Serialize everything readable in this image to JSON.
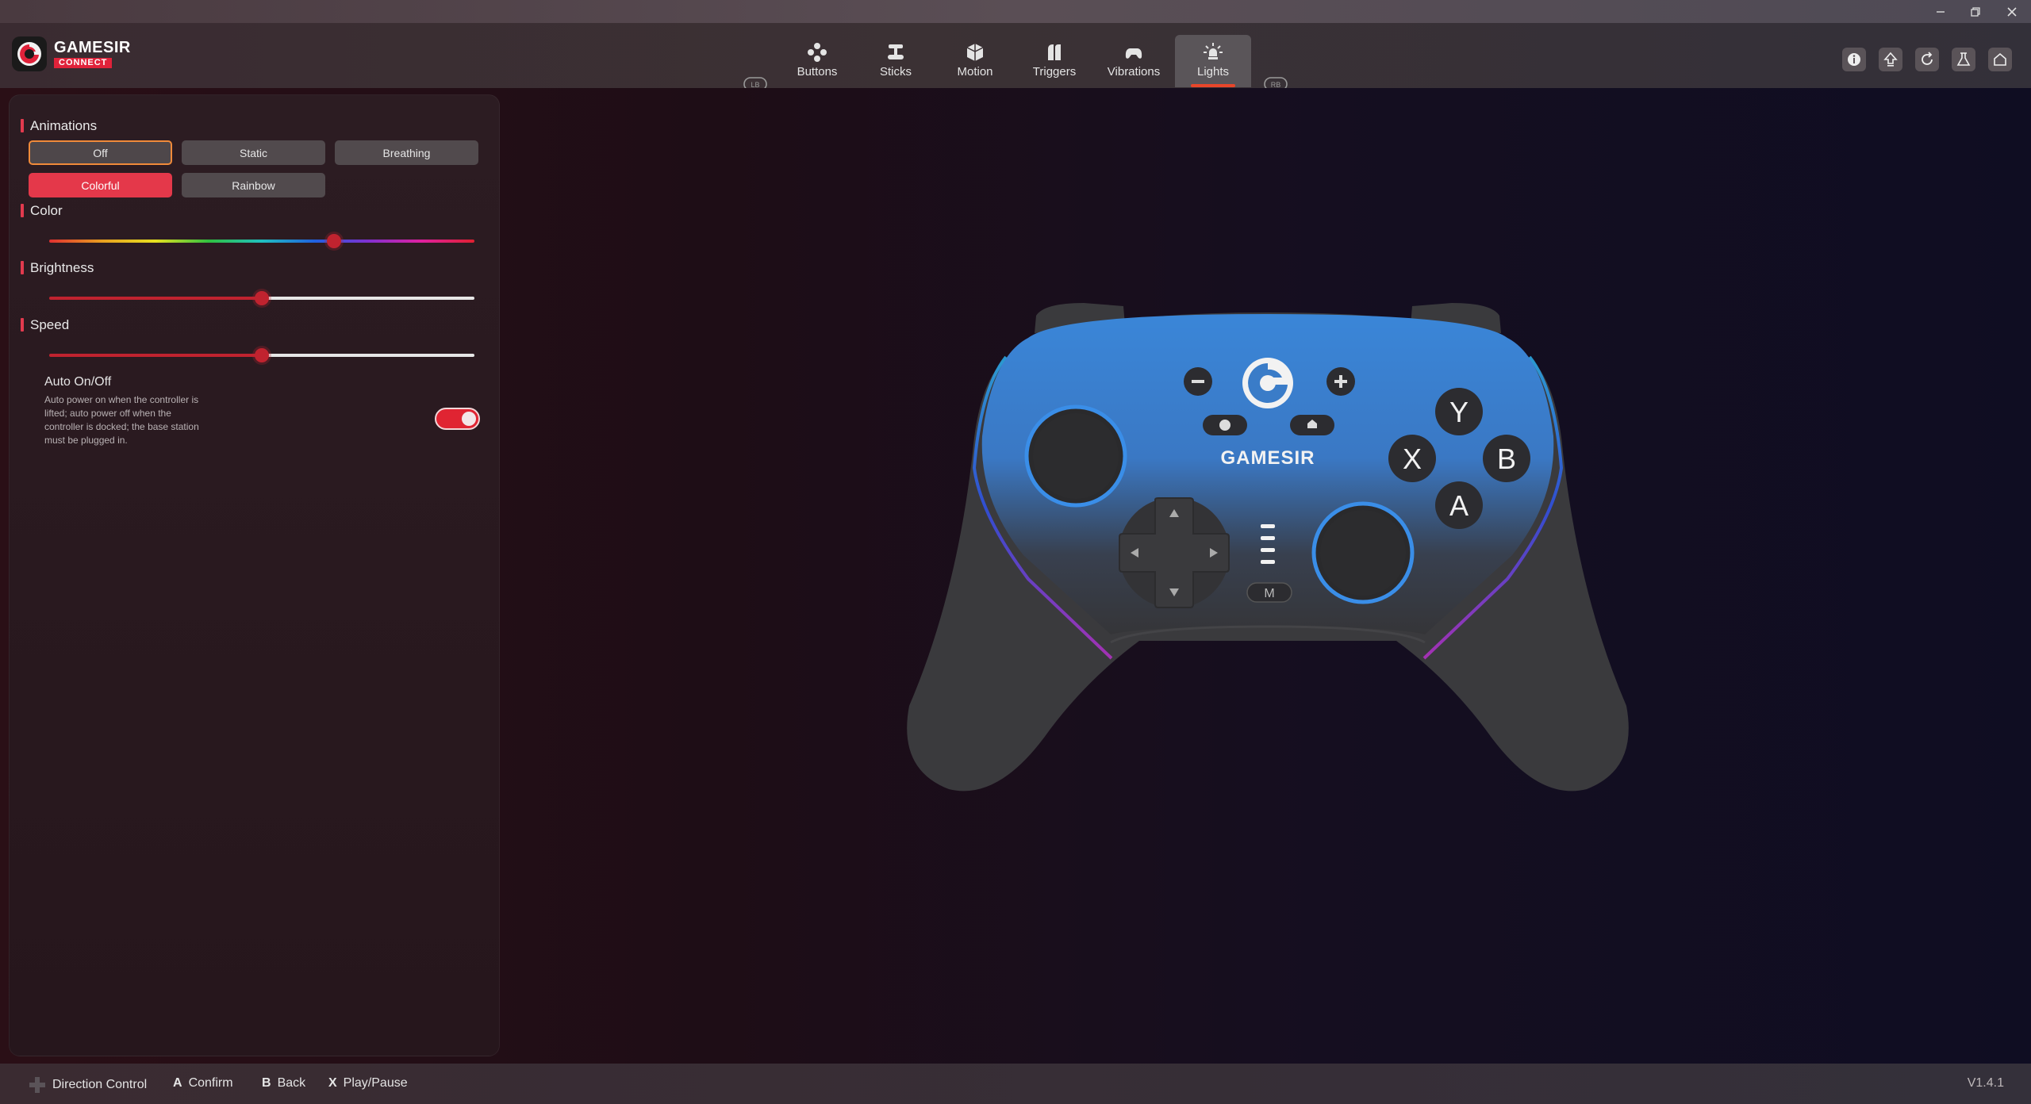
{
  "window": {
    "minimize_icon": "minimize-icon",
    "restore_icon": "restore-icon",
    "close_icon": "close-icon"
  },
  "brand": {
    "name": "GAMESIR",
    "tag": "CONNECT"
  },
  "nav": {
    "left_bumper": "LB",
    "right_bumper": "RB",
    "tabs": [
      {
        "label": "Buttons",
        "icon": "buttons-icon"
      },
      {
        "label": "Sticks",
        "icon": "sticks-icon"
      },
      {
        "label": "Motion",
        "icon": "motion-icon"
      },
      {
        "label": "Triggers",
        "icon": "triggers-icon"
      },
      {
        "label": "Vibrations",
        "icon": "vibrations-icon"
      },
      {
        "label": "Lights",
        "icon": "lights-icon"
      }
    ],
    "active_tab": "Lights",
    "tools": [
      "info-icon",
      "upgrade-icon",
      "reset-icon",
      "lab-icon",
      "home-icon"
    ]
  },
  "panel": {
    "animations": {
      "title": "Animations",
      "options": [
        "Off",
        "Static",
        "Breathing",
        "Colorful",
        "Rainbow"
      ],
      "selected": "Off",
      "highlighted": "Colorful"
    },
    "color": {
      "title": "Color",
      "value": 0.67
    },
    "brightness": {
      "title": "Brightness",
      "value": 0.5
    },
    "speed": {
      "title": "Speed",
      "value": 0.5
    },
    "auto_onoff": {
      "title": "Auto On/Off",
      "description": "Auto power on when the controller is lifted; auto power off when the controller is docked; the base station must be plugged in.",
      "enabled": true
    }
  },
  "controller": {
    "brand_label": "GAMESIR",
    "buttons": {
      "y": "Y",
      "x": "X",
      "b": "B",
      "a": "A",
      "m": "M"
    }
  },
  "footer": {
    "hints": [
      {
        "key": "",
        "label": "Direction Control",
        "icon": "dpad-icon"
      },
      {
        "key": "A",
        "label": "Confirm"
      },
      {
        "key": "B",
        "label": "Back"
      },
      {
        "key": "X",
        "label": "Play/Pause"
      }
    ],
    "version": "V1.4.1"
  },
  "colors": {
    "accent_red": "#e4384a",
    "accent_orange": "#f08a3a",
    "controller_blue": "#3a86d8"
  }
}
